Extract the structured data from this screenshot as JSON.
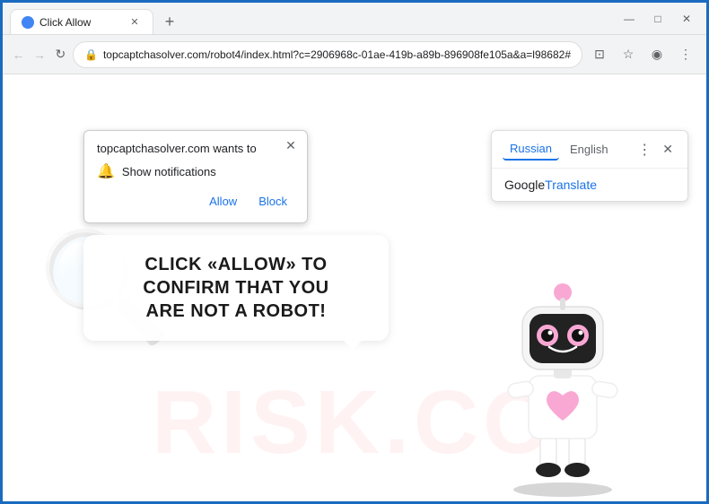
{
  "browser": {
    "tab": {
      "title": "Click Allow",
      "favicon": "●"
    },
    "new_tab_label": "+",
    "window_controls": {
      "minimize": "—",
      "maximize": "□",
      "close": "✕"
    },
    "nav": {
      "back": "←",
      "forward": "→",
      "refresh": "↻",
      "url": "topcaptchasolver.com/robot4/index.html?c=2906968c-01ae-419b-a89b-896908fe105a&a=l98682#",
      "lock_icon": "🔒"
    },
    "nav_actions": {
      "cast": "⊡",
      "bookmark": "☆",
      "profile": "◉",
      "menu": "⋮"
    }
  },
  "notification_popup": {
    "title": "topcaptchasolver.com wants to",
    "close_icon": "✕",
    "notification_label": "Show notifications",
    "bell_icon": "🔔",
    "allow_button": "Allow",
    "block_button": "Block"
  },
  "translate_popup": {
    "tab_russian": "Russian",
    "tab_english": "English",
    "more_icon": "⋮",
    "close_icon": "✕",
    "google_text": "Google",
    "translate_text": " Translate"
  },
  "page": {
    "bubble_text_line1": "CLICK «ALLOW» TO CONFIRM THAT YOU",
    "bubble_text_line2": "ARE NOT A ROBOT!",
    "watermark_text": "RISK.CO",
    "watermark_magnifier": "🔍"
  }
}
